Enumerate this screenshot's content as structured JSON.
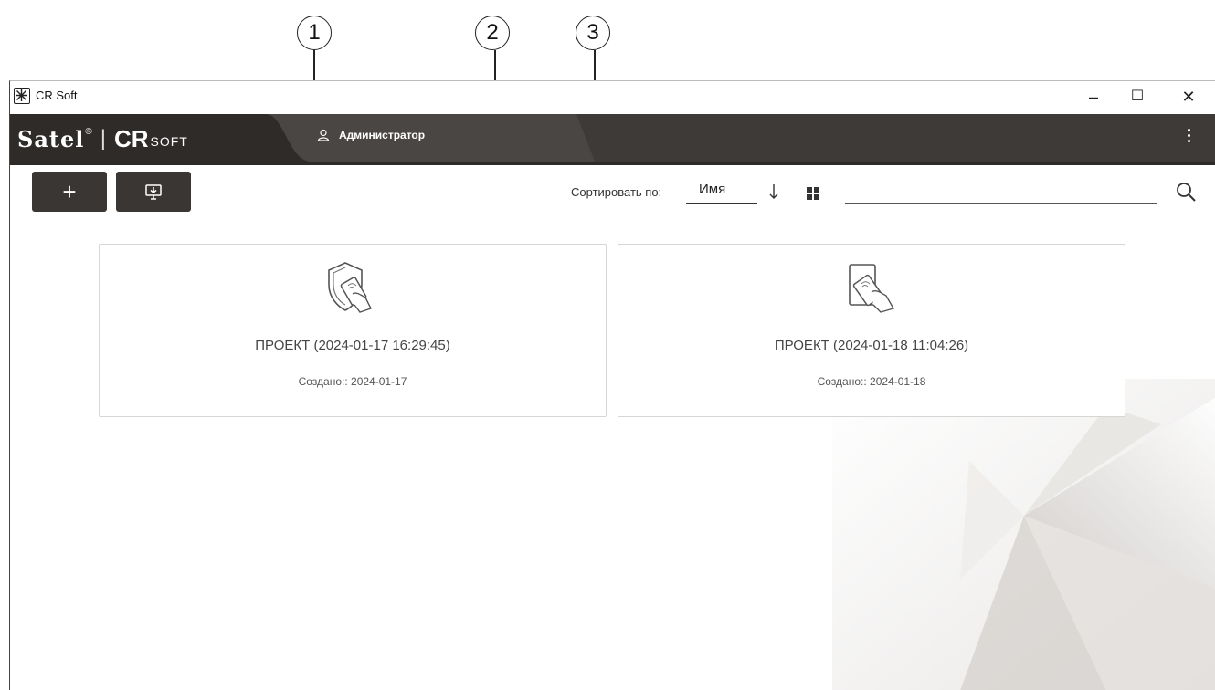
{
  "callouts": [
    "1",
    "2",
    "3"
  ],
  "window": {
    "title": "CR Soft",
    "minimize": "–",
    "maximize": "☐",
    "close": "✕"
  },
  "appbar": {
    "logo_brand": "Satel",
    "logo_reg": "®",
    "logo_sep": "|",
    "logo_cr": "CR",
    "logo_soft": "SOFT",
    "user_name": "Администратор"
  },
  "toolbar": {
    "add_label": "+",
    "sort_label": "Сортировать по:",
    "sort_value": "Имя",
    "search_value": ""
  },
  "projects": [
    {
      "name": "ПРОЕКТ (2024-01-17 16:29:45)",
      "created": "Создано:: 2024-01-17",
      "icon": "shield-card-icon"
    },
    {
      "name": "ПРОЕКТ (2024-01-18 11:04:26)",
      "created": "Создано:: 2024-01-18",
      "icon": "card-reader-icon"
    }
  ],
  "colors": {
    "appbar_bg": "#3e3a37",
    "button_bg": "#3a3633",
    "window_bg": "#ffffff"
  }
}
